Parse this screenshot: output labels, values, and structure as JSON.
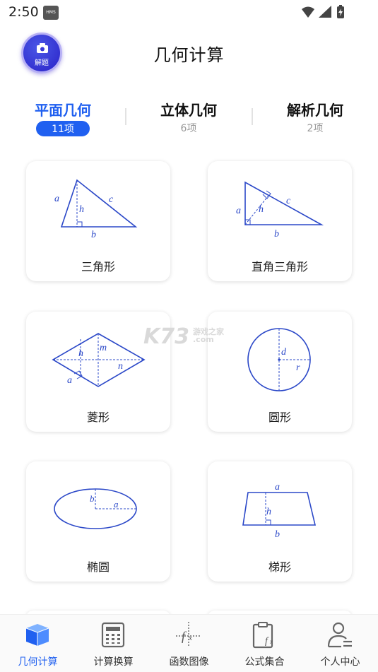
{
  "status_bar": {
    "time": "2:50",
    "badge": "HMS"
  },
  "header": {
    "title": "几何计算",
    "scan_label": "解题"
  },
  "tabs": [
    {
      "name": "平面几何",
      "count": "11项",
      "active": true
    },
    {
      "name": "立体几何",
      "count": "6项",
      "active": false
    },
    {
      "name": "解析几何",
      "count": "2项",
      "active": false
    }
  ],
  "cards": [
    {
      "label": "三角形",
      "icon": "triangle-icon"
    },
    {
      "label": "直角三角形",
      "icon": "right-triangle-icon"
    },
    {
      "label": "菱形",
      "icon": "rhombus-icon"
    },
    {
      "label": "圆形",
      "icon": "circle-icon"
    },
    {
      "label": "椭圆",
      "icon": "ellipse-icon"
    },
    {
      "label": "梯形",
      "icon": "trapezoid-icon"
    }
  ],
  "diagram_labels": {
    "triangle": {
      "a": "a",
      "b": "b",
      "c": "c",
      "h": "h"
    },
    "right_triangle": {
      "a": "a",
      "b": "b",
      "c": "c",
      "h": "h"
    },
    "rhombus": {
      "a": "a",
      "h": "h",
      "m": "m",
      "n": "n"
    },
    "circle": {
      "d": "d",
      "r": "r"
    },
    "ellipse": {
      "a": "a",
      "b": "b"
    },
    "trapezoid": {
      "a": "a",
      "b": "b",
      "h": "h"
    }
  },
  "watermark": {
    "brand": "K73",
    "sub": "游戏之家",
    "domain": ".com"
  },
  "nav": [
    {
      "label": "几何计算",
      "icon": "cube-icon",
      "active": true
    },
    {
      "label": "计算换算",
      "icon": "calculator-icon",
      "active": false
    },
    {
      "label": "函数图像",
      "icon": "function-graph-icon",
      "active": false
    },
    {
      "label": "公式集合",
      "icon": "formula-clipboard-icon",
      "active": false
    },
    {
      "label": "个人中心",
      "icon": "user-icon",
      "active": false
    }
  ],
  "colors": {
    "accent": "#2060f0",
    "diagram": "#2b48c8",
    "scan_button": "#2f2fd0"
  }
}
